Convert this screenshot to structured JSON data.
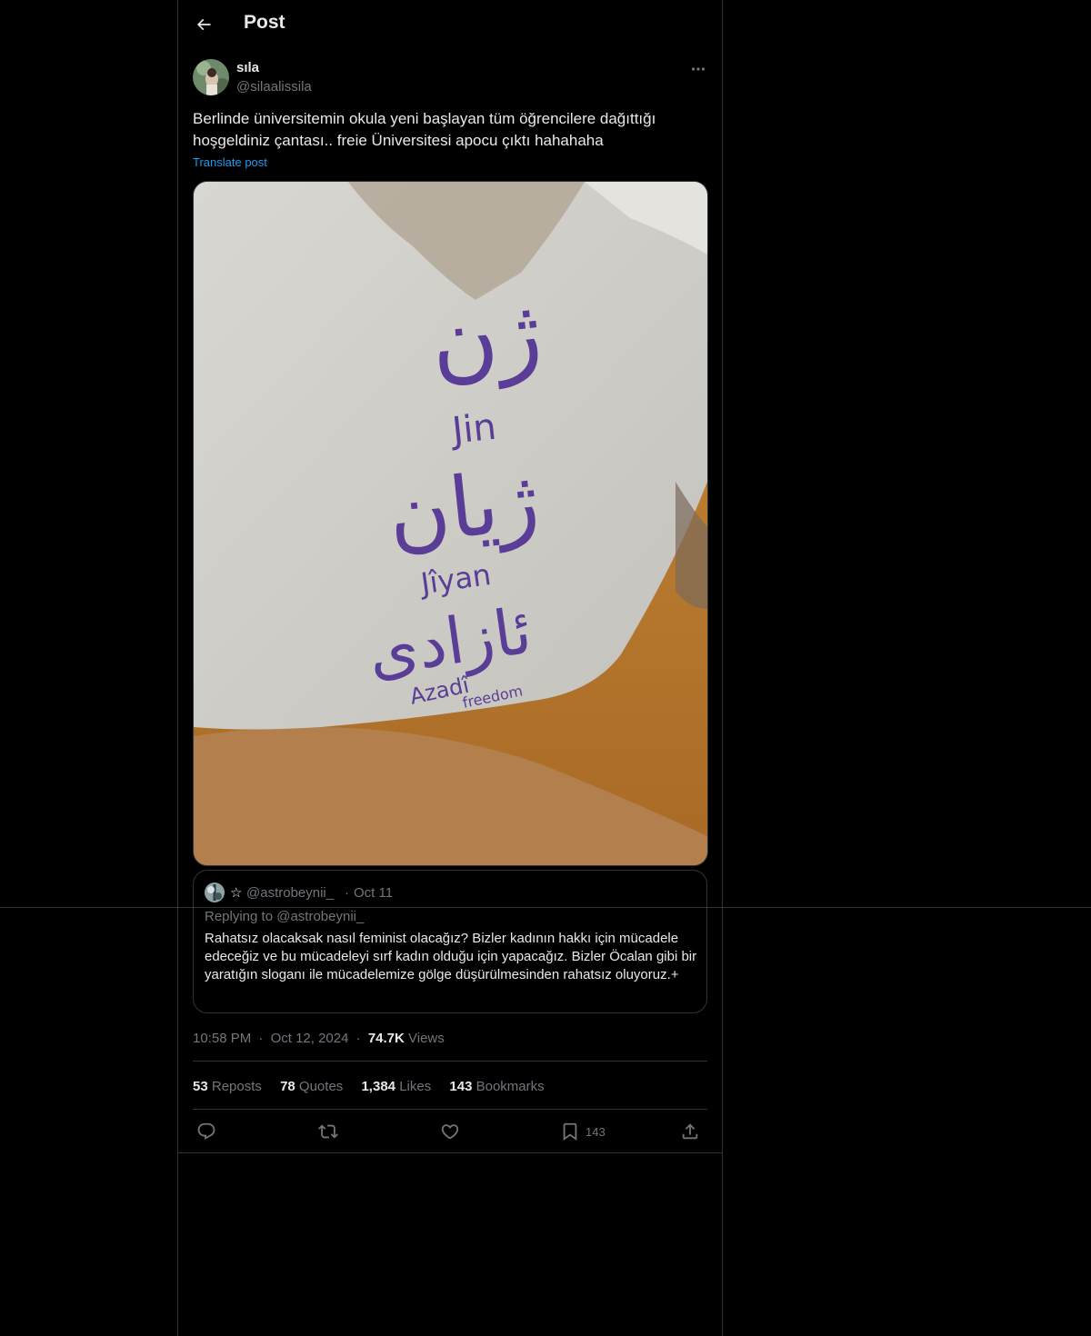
{
  "header": {
    "title": "Post",
    "back_icon": "arrow-left-icon"
  },
  "author": {
    "name": "sıla",
    "handle": "@silaalissila"
  },
  "post": {
    "text": "Berlinde üniversitemin okula yeni başlayan tüm öğrencilere dağıttığı hoşgeldiniz çantası.. freie Üniversitesi apocu çıktı hahahaha",
    "translate_label": "Translate post",
    "image_text": {
      "line1_script": "ژن",
      "line1_latin": "Jin",
      "line2_script": "ژیان",
      "line2_latin": "Jîyan",
      "line3_script": "ئازادی",
      "line3_latin": "Azadî",
      "line4_latin": "freedom"
    }
  },
  "quoted": {
    "name": "☆",
    "handle": "@astrobeynii_",
    "separator": "·",
    "date": "Oct 11",
    "replying": "Replying to @astrobeynii_",
    "text": "Rahatsız olacaksak nasıl feminist olacağız? Bizler kadının hakkı için mücadele edeceğiz ve bu mücadeleyi sırf kadın olduğu için yapacağız. Bizler Öcalan gibi bir yaratığın sloganı ile mücadelemize gölge düşürülmesinden rahatsız oluyoruz.+"
  },
  "meta": {
    "time": "10:58 PM",
    "sep": "·",
    "date": "Oct 12, 2024",
    "views_count": "74.7K",
    "views_label": "Views"
  },
  "stats": {
    "reposts_count": "53",
    "reposts_label": "Reposts",
    "quotes_count": "78",
    "quotes_label": "Quotes",
    "likes_count": "1,384",
    "likes_label": "Likes",
    "bookmarks_count": "143",
    "bookmarks_label": "Bookmarks"
  },
  "actions": {
    "reply_icon": "reply-icon",
    "repost_icon": "repost-icon",
    "like_icon": "heart-icon",
    "bookmark_icon": "bookmark-icon",
    "bookmark_count": "143",
    "share_icon": "share-icon"
  },
  "colors": {
    "background": "#000000",
    "text": "#e7e9ea",
    "muted": "#71767b",
    "link": "#1d9bf0",
    "border": "#2f3336",
    "print_purple": "#5a3d96"
  }
}
